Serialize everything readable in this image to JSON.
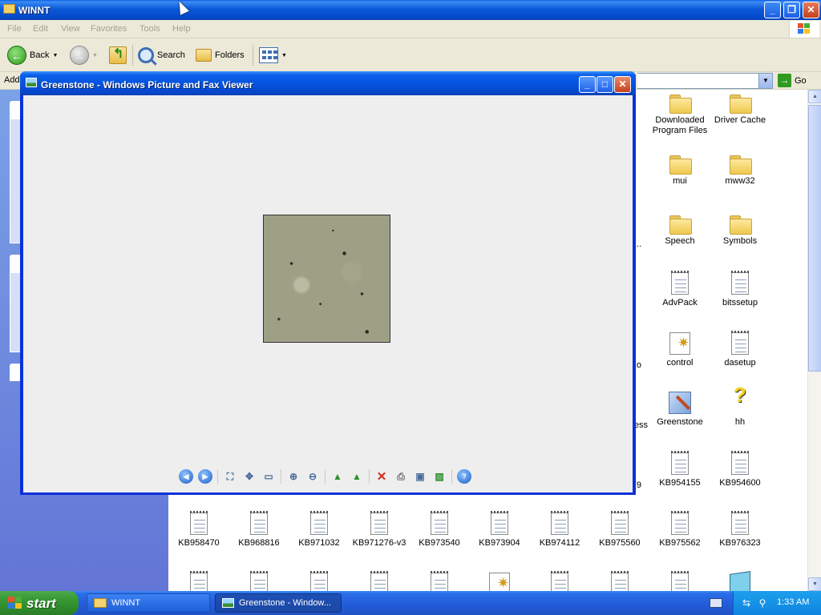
{
  "explorer": {
    "title": "WINNT",
    "menu": [
      "File",
      "Edit",
      "View",
      "Favorites",
      "Tools",
      "Help"
    ],
    "toolbar": {
      "back": "Back",
      "search": "Search",
      "folders": "Folders"
    },
    "address": {
      "label": "Addr",
      "go": "Go",
      "value": ""
    },
    "files": [
      {
        "name": "Downloaded Program Files",
        "icon": "folder-icon"
      },
      {
        "name": "Driver Cache",
        "icon": "folder-icon"
      },
      {
        "name": "mui",
        "icon": "folder-icon"
      },
      {
        "name": "mww32",
        "icon": "folder-icon"
      },
      {
        "name": "Speech",
        "icon": "folder-icon"
      },
      {
        "name": "Symbols",
        "icon": "folder-icon"
      },
      {
        "name": "AdvPack",
        "icon": "text-file-icon"
      },
      {
        "name": "bitssetup",
        "icon": "text-file-icon"
      },
      {
        "name": "control",
        "icon": "control-file-icon"
      },
      {
        "name": "dasetup",
        "icon": "text-file-icon"
      },
      {
        "name": "Greenstone",
        "icon": "bitmap-file-icon"
      },
      {
        "name": "hh",
        "icon": "help-file-icon"
      },
      {
        "name": "KB954155",
        "icon": "text-file-icon"
      },
      {
        "name": "KB954600",
        "icon": "text-file-icon"
      },
      {
        "name": "KB958470",
        "icon": "text-file-icon"
      },
      {
        "name": "KB968816",
        "icon": "text-file-icon"
      },
      {
        "name": "KB971032",
        "icon": "text-file-icon"
      },
      {
        "name": "KB971276-v3",
        "icon": "text-file-icon"
      },
      {
        "name": "KB973540",
        "icon": "text-file-icon"
      },
      {
        "name": "KB973904",
        "icon": "text-file-icon"
      },
      {
        "name": "KB974112",
        "icon": "text-file-icon"
      },
      {
        "name": "KB975560",
        "icon": "text-file-icon"
      },
      {
        "name": "KB975562",
        "icon": "text-file-icon"
      },
      {
        "name": "KB976323",
        "icon": "text-file-icon"
      }
    ],
    "partial_labels": [
      "...",
      "o",
      "ess",
      "9"
    ]
  },
  "viewer": {
    "title": "Greenstone - Windows Picture and Fax Viewer",
    "toolbar_icons": [
      "previous-image-icon",
      "next-image-icon",
      "best-fit-icon",
      "actual-size-icon",
      "slideshow-icon",
      "zoom-in-icon",
      "zoom-out-icon",
      "rotate-clockwise-icon",
      "rotate-counterclockwise-icon",
      "delete-icon",
      "print-icon",
      "save-icon",
      "open-editor-icon",
      "help-icon"
    ]
  },
  "taskbar": {
    "start_label": "start",
    "buttons": [
      {
        "label": "WINNT",
        "icon": "folder-icon"
      },
      {
        "label": "Greenstone - Window...",
        "icon": "picture-viewer-icon"
      }
    ],
    "clock": "1:33 AM"
  },
  "colors": {
    "xp_blue": "#0654e0",
    "start_green": "#3a9b37",
    "tray_blue": "#0f85e0",
    "viewer_background": "#eeeeee"
  }
}
